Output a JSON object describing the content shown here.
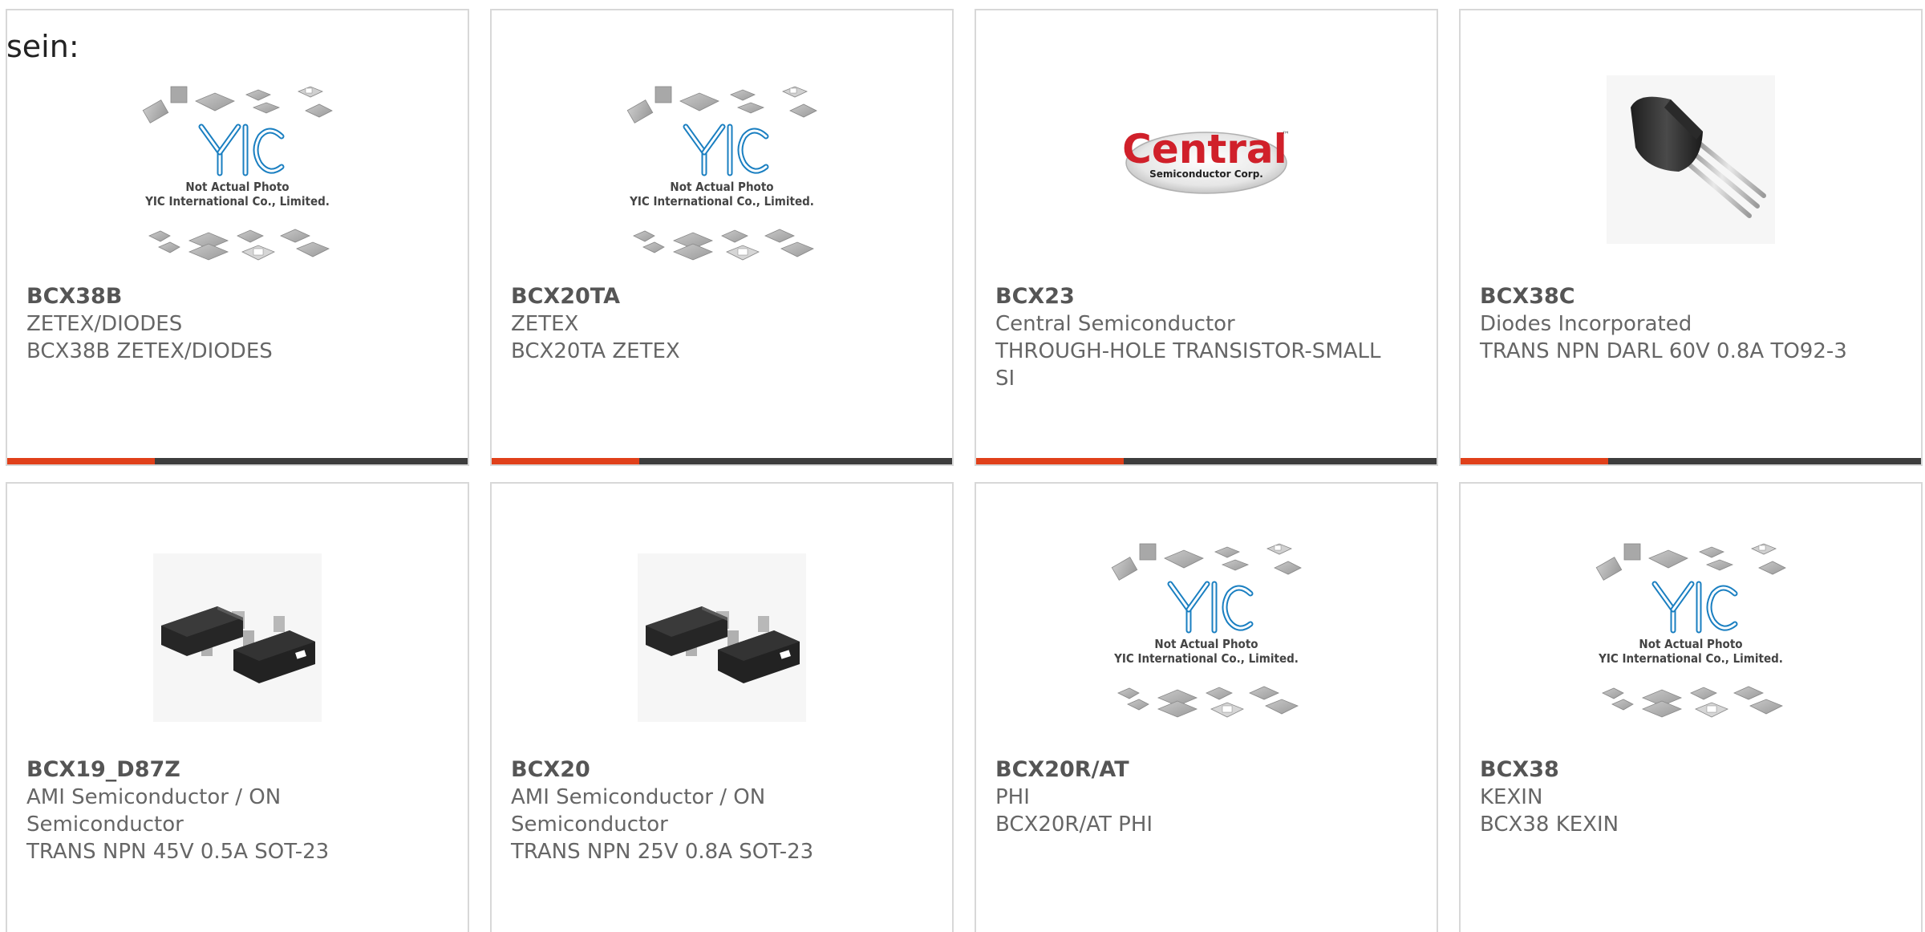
{
  "intro_text": "sein:",
  "placeholder": {
    "brand": "YIC",
    "line1": "Not Actual Photo",
    "line2": "YIC International Co., Limited."
  },
  "central_logo": {
    "name": "Central",
    "tagline": "Semiconductor Corp.",
    "tm": "™"
  },
  "colors": {
    "accent": "#e0401a",
    "bar": "#3d3d3d",
    "border": "#d8d8d8",
    "text": "#666666"
  },
  "products": [
    {
      "part": "BCX38B",
      "mfr": "ZETEX/DIODES",
      "desc": "BCX38B ZETEX/DIODES",
      "image": "yic-placeholder"
    },
    {
      "part": "BCX20TA",
      "mfr": "ZETEX",
      "desc": "BCX20TA ZETEX",
      "image": "yic-placeholder"
    },
    {
      "part": "BCX23",
      "mfr": "Central Semiconductor",
      "desc": "THROUGH-HOLE TRANSISTOR-SMALL SI",
      "image": "central-logo"
    },
    {
      "part": "BCX38C",
      "mfr": "Diodes Incorporated",
      "desc": "TRANS NPN DARL 60V 0.8A TO92-3",
      "image": "to92-transistor"
    },
    {
      "part": "BCX19_D87Z",
      "mfr": "AMI Semiconductor / ON Semiconductor",
      "desc": "TRANS NPN 45V 0.5A SOT-23",
      "image": "sot23-transistor"
    },
    {
      "part": "BCX20",
      "mfr": "AMI Semiconductor / ON Semiconductor",
      "desc": "TRANS NPN 25V 0.8A SOT-23",
      "image": "sot23-transistor"
    },
    {
      "part": "BCX20R/AT",
      "mfr": "PHI",
      "desc": "BCX20R/AT PHI",
      "image": "yic-placeholder"
    },
    {
      "part": "BCX38",
      "mfr": "KEXIN",
      "desc": "BCX38 KEXIN",
      "image": "yic-placeholder"
    }
  ]
}
